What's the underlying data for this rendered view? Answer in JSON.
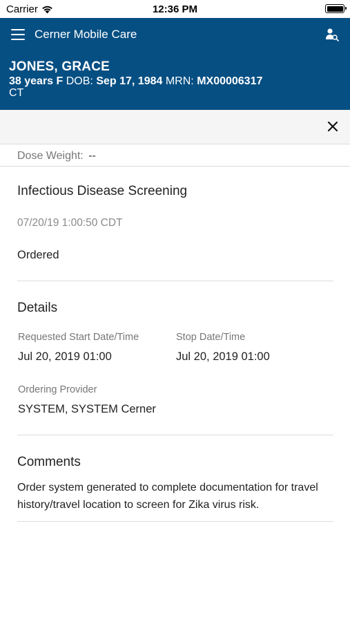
{
  "status_bar": {
    "carrier": "Carrier",
    "time": "12:36 PM"
  },
  "header": {
    "app_title": "Cerner Mobile Care",
    "patient": {
      "name": "JONES, GRACE",
      "age_sex": "38 years F",
      "dob_label": "DOB:",
      "dob": "Sep 17, 1984",
      "mrn_label": "MRN:",
      "mrn": "MX00006317",
      "location": "CT"
    }
  },
  "dose": {
    "label": "Dose Weight:",
    "value": "--"
  },
  "order": {
    "title": "Infectious Disease Screening",
    "timestamp": "07/20/19 1:00:50 CDT",
    "status": "Ordered"
  },
  "details": {
    "title": "Details",
    "start_label": "Requested Start Date/Time",
    "start_value": "Jul 20, 2019 01:00",
    "stop_label": "Stop Date/Time",
    "stop_value": "Jul 20, 2019 01:00",
    "provider_label": "Ordering Provider",
    "provider_value": "SYSTEM, SYSTEM Cerner"
  },
  "comments": {
    "title": "Comments",
    "text": "Order system generated to complete documentation for travel history/travel location to screen for Zika virus risk."
  },
  "colors": {
    "header_bg": "#064f83",
    "toolbar_bg": "#f5f5f5"
  },
  "icons": {
    "menu": "hamburger-menu-icon",
    "patient_search": "patient-search-icon",
    "close": "close-icon",
    "wifi": "wifi-icon",
    "battery": "battery-icon"
  }
}
